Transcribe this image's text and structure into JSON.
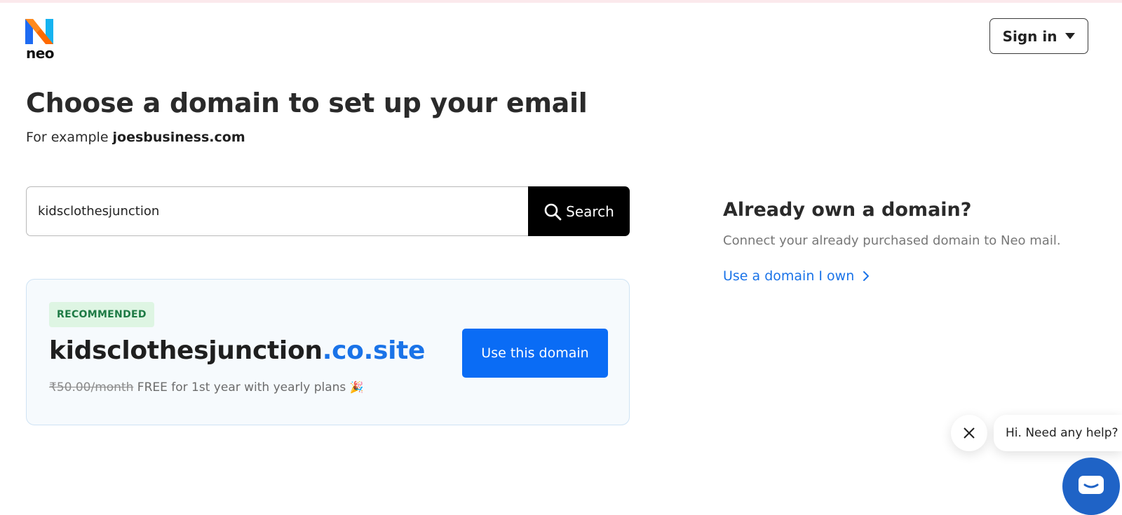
{
  "brand": {
    "name": "neo",
    "logo_colors": [
      "#ff6a00",
      "#1e6bf2",
      "#16b3f0"
    ]
  },
  "header": {
    "signin_label": "Sign in",
    "signin_icon": "caret-down-icon"
  },
  "main": {
    "title": "Choose a domain to set up your email",
    "example_prefix": "For example ",
    "example_domain": "joesbusiness.com"
  },
  "search": {
    "value": "kidsclothesjunction",
    "button_label": "Search",
    "button_icon": "search-icon"
  },
  "recommendation": {
    "badge": "RECOMMENDED",
    "domain_base": "kidsclothesjunction",
    "domain_tld": ".co.site",
    "old_price": "₹50.00/month",
    "offer": "FREE for 1st year with yearly plans",
    "offer_icon": "🎉",
    "button_label": "Use this domain"
  },
  "own_domain": {
    "title": "Already own a domain?",
    "description": "Connect your already purchased domain to Neo mail.",
    "link_label": "Use a domain I own",
    "link_icon": "chevron-right-icon"
  },
  "chat": {
    "bubble_text": "Hi. Need any help?",
    "close_icon": "close-icon",
    "launcher_icon": "chat-icon"
  },
  "colors": {
    "primary_button": "#0a6cf5",
    "link": "#1a73e8",
    "badge_bg": "#def5e3",
    "badge_text": "#1e7b45",
    "chat_launcher": "#1f63c6"
  }
}
